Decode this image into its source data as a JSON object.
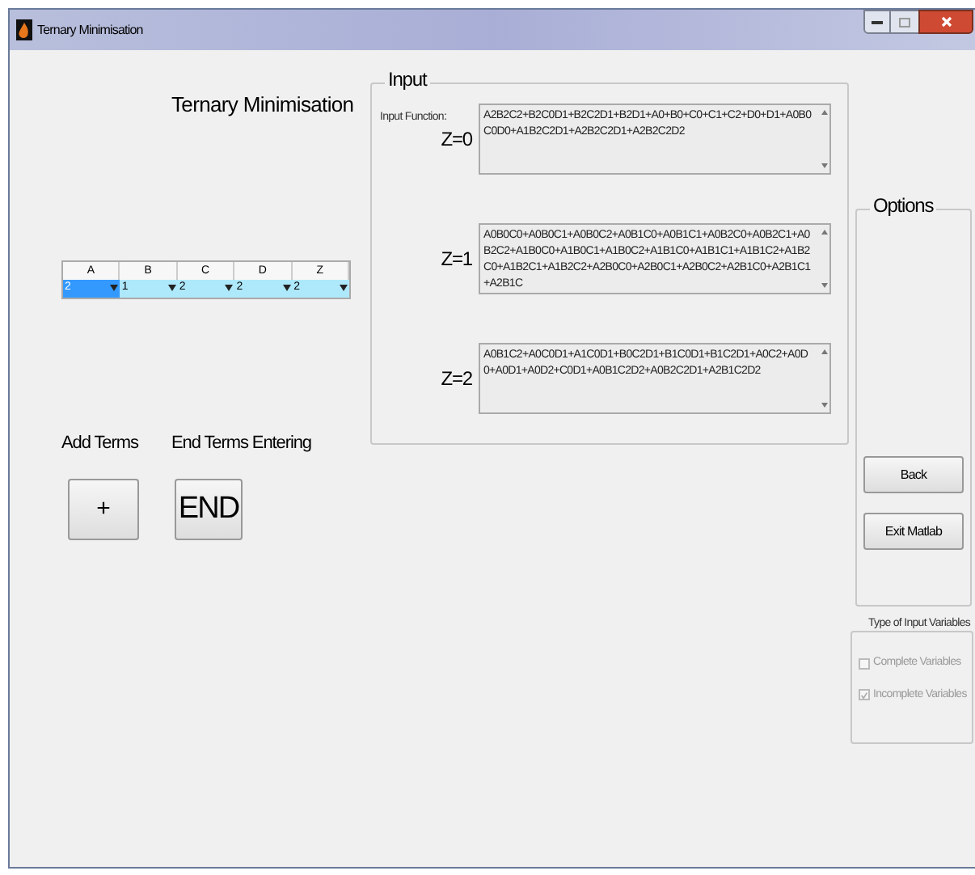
{
  "window": {
    "title": "Ternary Minimisation"
  },
  "heading": "Ternary Minimisation",
  "table": {
    "columns": [
      "A",
      "B",
      "C",
      "D",
      "Z"
    ],
    "cells": [
      {
        "value": "2",
        "selected": true
      },
      {
        "value": "1",
        "selected": false
      },
      {
        "value": "2",
        "selected": false
      },
      {
        "value": "2",
        "selected": false
      },
      {
        "value": "2",
        "selected": false
      }
    ]
  },
  "add_terms": {
    "label": "Add Terms",
    "button": "+"
  },
  "end_terms": {
    "label": "End Terms Entering",
    "button": "END"
  },
  "input": {
    "title": "Input",
    "function_label": "Input Function:",
    "functions": [
      {
        "label": "Z=0",
        "value": "A2B2C2+B2C0D1+B2C2D1+B2D1+A0+B0+C0+C1+C2+D0+D1+A0B0C0D0+A1B2C2D1+A2B2C2D1+A2B2C2D2"
      },
      {
        "label": "Z=1",
        "value": "A0B0C0+A0B0C1+A0B0C2+A0B1C0+A0B1C1+A0B2C0+A0B2C1+A0B2C2+A1B0C0+A1B0C1+A1B0C2+A1B1C0+A1B1C1+A1B1C2+A1B2C0+A1B2C1+A1B2C2+A2B0C0+A2B0C1+A2B0C2+A2B1C0+A2B1C1+A2B1C"
      },
      {
        "label": "Z=2",
        "value": "A0B1C2+A0C0D1+A1C0D1+B0C2D1+B1C0D1+B1C2D1+A0C2+A0D0+A0D1+A0D2+C0D1+A0B1C2D2+A0B2C2D1+A2B1C2D2"
      }
    ]
  },
  "options": {
    "title": "Options",
    "buttons": [
      "Back",
      "Exit Matlab"
    ]
  },
  "variable_type": {
    "title": "Type of Input Variables",
    "disabled": true,
    "options": [
      {
        "label": "Complete Variables",
        "checked": false
      },
      {
        "label": "Incomplete Variables",
        "checked": true
      }
    ]
  }
}
